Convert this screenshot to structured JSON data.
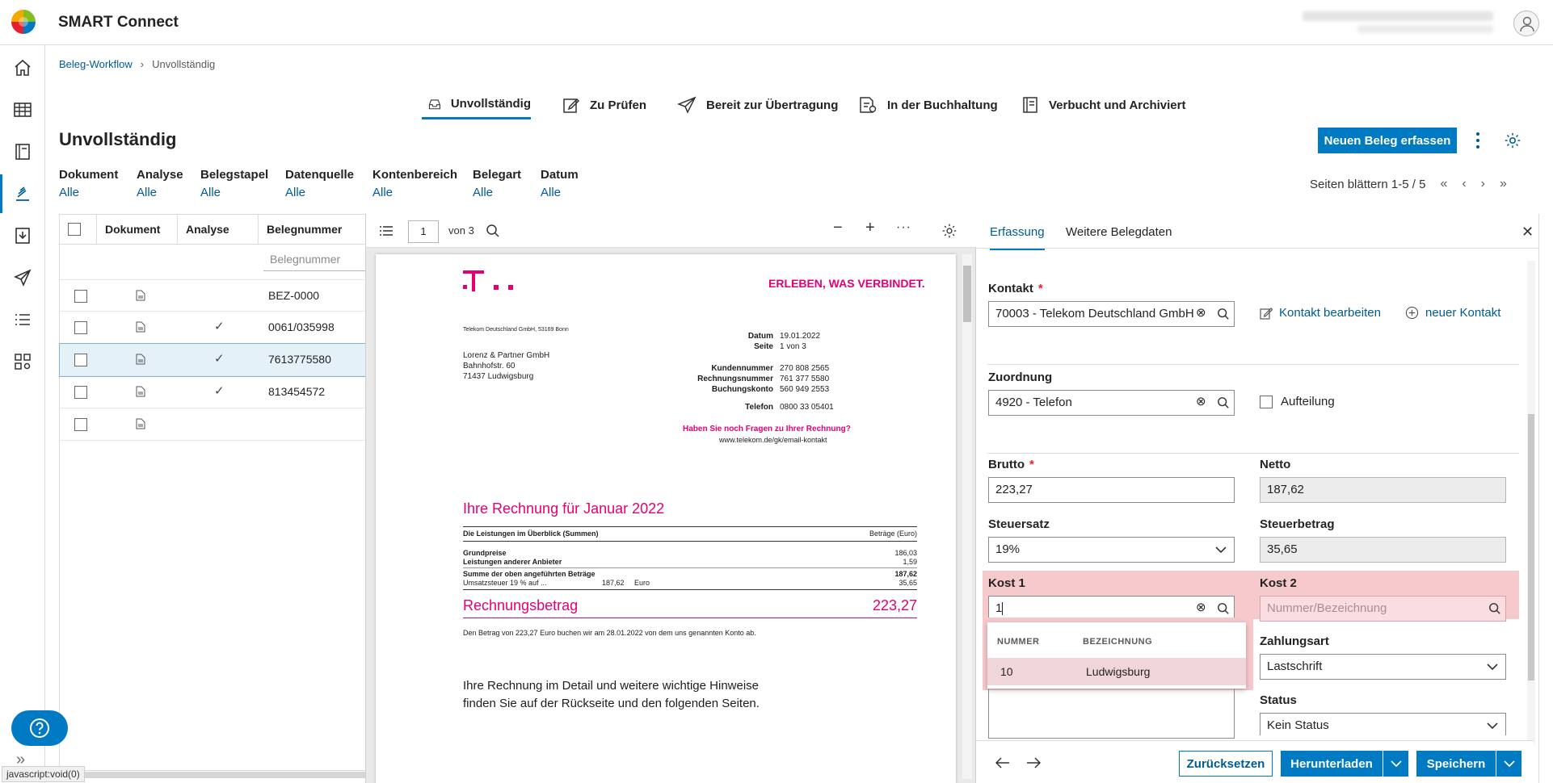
{
  "app": {
    "title": "SMART Connect"
  },
  "breadcrumb": {
    "root": "Beleg-Workflow",
    "separator": "›",
    "current": "Unvollständig"
  },
  "workflow_tabs": [
    {
      "label": "Unvollständig",
      "icon": "inbox-icon",
      "active": true
    },
    {
      "label": "Zu Prüfen",
      "icon": "edit-icon"
    },
    {
      "label": "Bereit zur Übertragung",
      "icon": "send-icon"
    },
    {
      "label": "In der Buchhaltung",
      "icon": "ledger-icon"
    },
    {
      "label": "Verbucht und Archiviert",
      "icon": "archive-icon"
    }
  ],
  "page": {
    "title": "Unvollständig",
    "new_button": "Neuen Beleg erfassen"
  },
  "filters": [
    {
      "label": "Dokument",
      "value": "Alle"
    },
    {
      "label": "Analyse",
      "value": "Alle"
    },
    {
      "label": "Belegstapel",
      "value": "Alle"
    },
    {
      "label": "Datenquelle",
      "value": "Alle"
    },
    {
      "label": "Kontenbereich",
      "value": "Alle"
    },
    {
      "label": "Belegart",
      "value": "Alle"
    },
    {
      "label": "Datum",
      "value": "Alle"
    }
  ],
  "pager": {
    "label": "Seiten blättern 1-5 / 5"
  },
  "table": {
    "headers": [
      "Dokument",
      "Analyse",
      "Belegnummer"
    ],
    "filter_placeholder": "Belegnummer",
    "rows": [
      {
        "belegnummer": "BEZ-0000",
        "analyzed": false,
        "selected": false
      },
      {
        "belegnummer": "0061/035998",
        "analyzed": true,
        "selected": false
      },
      {
        "belegnummer": "7613775580",
        "analyzed": true,
        "selected": true
      },
      {
        "belegnummer": "813454572",
        "analyzed": true,
        "selected": false
      },
      {
        "belegnummer": "",
        "analyzed": false,
        "selected": false
      }
    ]
  },
  "viewer": {
    "page": "1",
    "of_label": "von 3"
  },
  "invoice": {
    "slogan": "ERLEBEN, WAS VERBINDET.",
    "sender_line": "Telekom Deutschland GmbH, 53169 Bonn",
    "recipient": [
      "Lorenz & Partner GmbH",
      "Bahnhofstr. 60",
      "71437 Ludwigsburg"
    ],
    "meta": [
      {
        "k": "Datum",
        "v": "19.01.2022"
      },
      {
        "k": "Seite",
        "v": "1  von  3"
      },
      {
        "k": "Kundennummer",
        "v": "270 808 2565"
      },
      {
        "k": "Rechnungsnummer",
        "v": "761 377 5580"
      },
      {
        "k": "Buchungskonto",
        "v": "560 949 2553"
      },
      {
        "k": "Telefon",
        "v": "0800 33 05401"
      }
    ],
    "question": "Haben Sie noch Fragen zu Ihrer Rechnung?",
    "web": "www.telekom.de/gk/email-kontakt",
    "heading": "Ihre Rechnung für Januar 2022",
    "overview_label": "Die Leistungen im Überblick (Summen)",
    "overview_unit": "Beträge (Euro)",
    "lines": [
      {
        "k": "Grundpreise",
        "v": "186,03"
      },
      {
        "k": "Leistungen anderer Anbieter",
        "v": "1,59"
      }
    ],
    "sum_label": "Summe der oben angeführten Beträge",
    "sum_value": "187,62",
    "vat_label": "Umsatzsteuer 19 % auf ...",
    "vat_base": "187,62",
    "vat_currency": "Euro",
    "vat_value": "35,65",
    "total_label": "Rechnungsbetrag",
    "total_value": "223,27",
    "debit_note": "Den Betrag von 223,27 Euro buchen wir am 28.01.2022 von dem uns genannten Konto ab.",
    "detail_1": "Ihre Rechnung im Detail und weitere wichtige Hinweise",
    "detail_2": "finden Sie auf der Rückseite und den folgenden Seiten."
  },
  "form": {
    "tabs": [
      "Erfassung",
      "Weitere Belegdaten"
    ],
    "kontakt_label": "Kontakt",
    "kontakt_value": "70003 - Telekom Deutschland GmbH",
    "kontakt_edit": "Kontakt bearbeiten",
    "kontakt_new": "neuer Kontakt",
    "zuordnung_label": "Zuordnung",
    "zuordnung_value": "4920 - Telefon",
    "aufteilung_label": "Aufteilung",
    "brutto_label": "Brutto",
    "brutto_value": "223,27",
    "netto_label": "Netto",
    "netto_value": "187,62",
    "steuersatz_label": "Steuersatz",
    "steuersatz_value": "19%",
    "steuerbetrag_label": "Steuerbetrag",
    "steuerbetrag_value": "35,65",
    "kost1_label": "Kost 1",
    "kost1_value": "1",
    "kost2_label": "Kost 2",
    "kost2_placeholder": "Nummer/Bezeichnung",
    "dropdown": {
      "col_nummer": "NUMMER",
      "col_bezeichnung": "BEZEICHNUNG",
      "rows": [
        {
          "nummer": "10",
          "bezeichnung": "Ludwigsburg"
        }
      ]
    },
    "zahlungsart_label": "Zahlungsart",
    "zahlungsart_value": "Lastschrift",
    "status_label": "Status",
    "status_value": "Kein Status"
  },
  "actions": {
    "reset": "Zurücksetzen",
    "download": "Herunterladen",
    "save": "Speichern"
  },
  "statusbar": "javascript:void(0)",
  "colors": {
    "accent": "#007ac3",
    "link": "#005b92",
    "telekom": "#e20074",
    "highlight": "#f6c9cd"
  }
}
